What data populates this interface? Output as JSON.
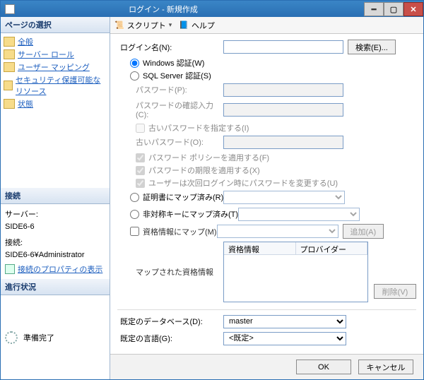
{
  "window": {
    "title": "ログイン - 新規作成"
  },
  "left": {
    "pages_header": "ページの選択",
    "pages": [
      "全般",
      "サーバー ロール",
      "ユーザー マッピング",
      "セキュリティ保護可能なリソース",
      "状態"
    ],
    "connection_header": "接続",
    "connection": {
      "server_label": "サーバー:",
      "server_value": "SIDE6-6",
      "conn_label": "接続:",
      "conn_value": "SIDE6-6¥Administrator",
      "props_link": "接続のプロパティの表示"
    },
    "progress_header": "進行状況",
    "progress_text": "準備完了"
  },
  "toolbar": {
    "script": "スクリプト",
    "help": "ヘルプ"
  },
  "form": {
    "login_name_label": "ログイン名(N):",
    "login_name_value": "",
    "search_btn": "検索(E)...",
    "auth": {
      "windows": "Windows 認証(W)",
      "sql": "SQL Server 認証(S)"
    },
    "password_label": "パスワード(P):",
    "password_confirm_label": "パスワードの確認入力(C):",
    "specify_old_pw": "古いパスワードを指定する(I)",
    "old_pw_label": "古いパスワード(O):",
    "enforce_policy": "パスワード ポリシーを適用する(F)",
    "enforce_expiration": "パスワードの期限を適用する(X)",
    "must_change": "ユーザーは次回ログイン時にパスワードを変更する(U)",
    "mapped_cert": "証明書にマップ済み(R)",
    "mapped_asym": "非対称キーにマップ済み(T)",
    "map_credential": "資格情報にマップ(M)",
    "add_btn": "追加(A)",
    "mapped_credentials_label": "マップされた資格情報",
    "cred_col1": "資格情報",
    "cred_col2": "プロバイダー",
    "remove_btn": "削除(V)",
    "default_db_label": "既定のデータベース(D):",
    "default_db_value": "master",
    "default_lang_label": "既定の言語(G):",
    "default_lang_value": "<既定>"
  },
  "footer": {
    "ok": "OK",
    "cancel": "キャンセル"
  }
}
